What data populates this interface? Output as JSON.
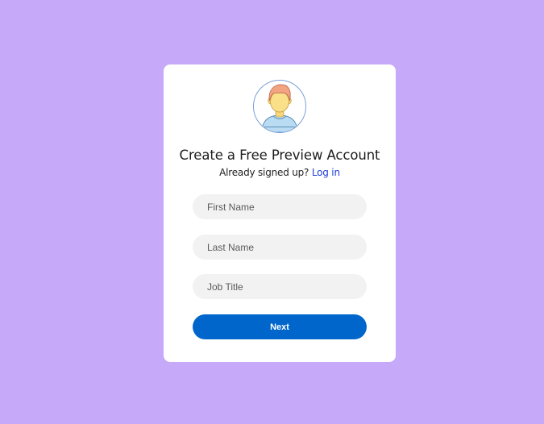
{
  "form": {
    "title": "Create a Free Preview Account",
    "signed_up_prompt": "Already signed up?",
    "login_link": "Log in",
    "fields": [
      {
        "placeholder": "First Name",
        "value": ""
      },
      {
        "placeholder": "Last Name",
        "value": ""
      },
      {
        "placeholder": "Job Title",
        "value": ""
      }
    ],
    "next_label": "Next"
  },
  "colors": {
    "background": "#c6a9f9",
    "card": "#ffffff",
    "field_background": "#f2f2f2",
    "button": "#0066cc",
    "link": "#1e3ee0"
  },
  "icons": {
    "avatar": "user-avatar-icon"
  }
}
